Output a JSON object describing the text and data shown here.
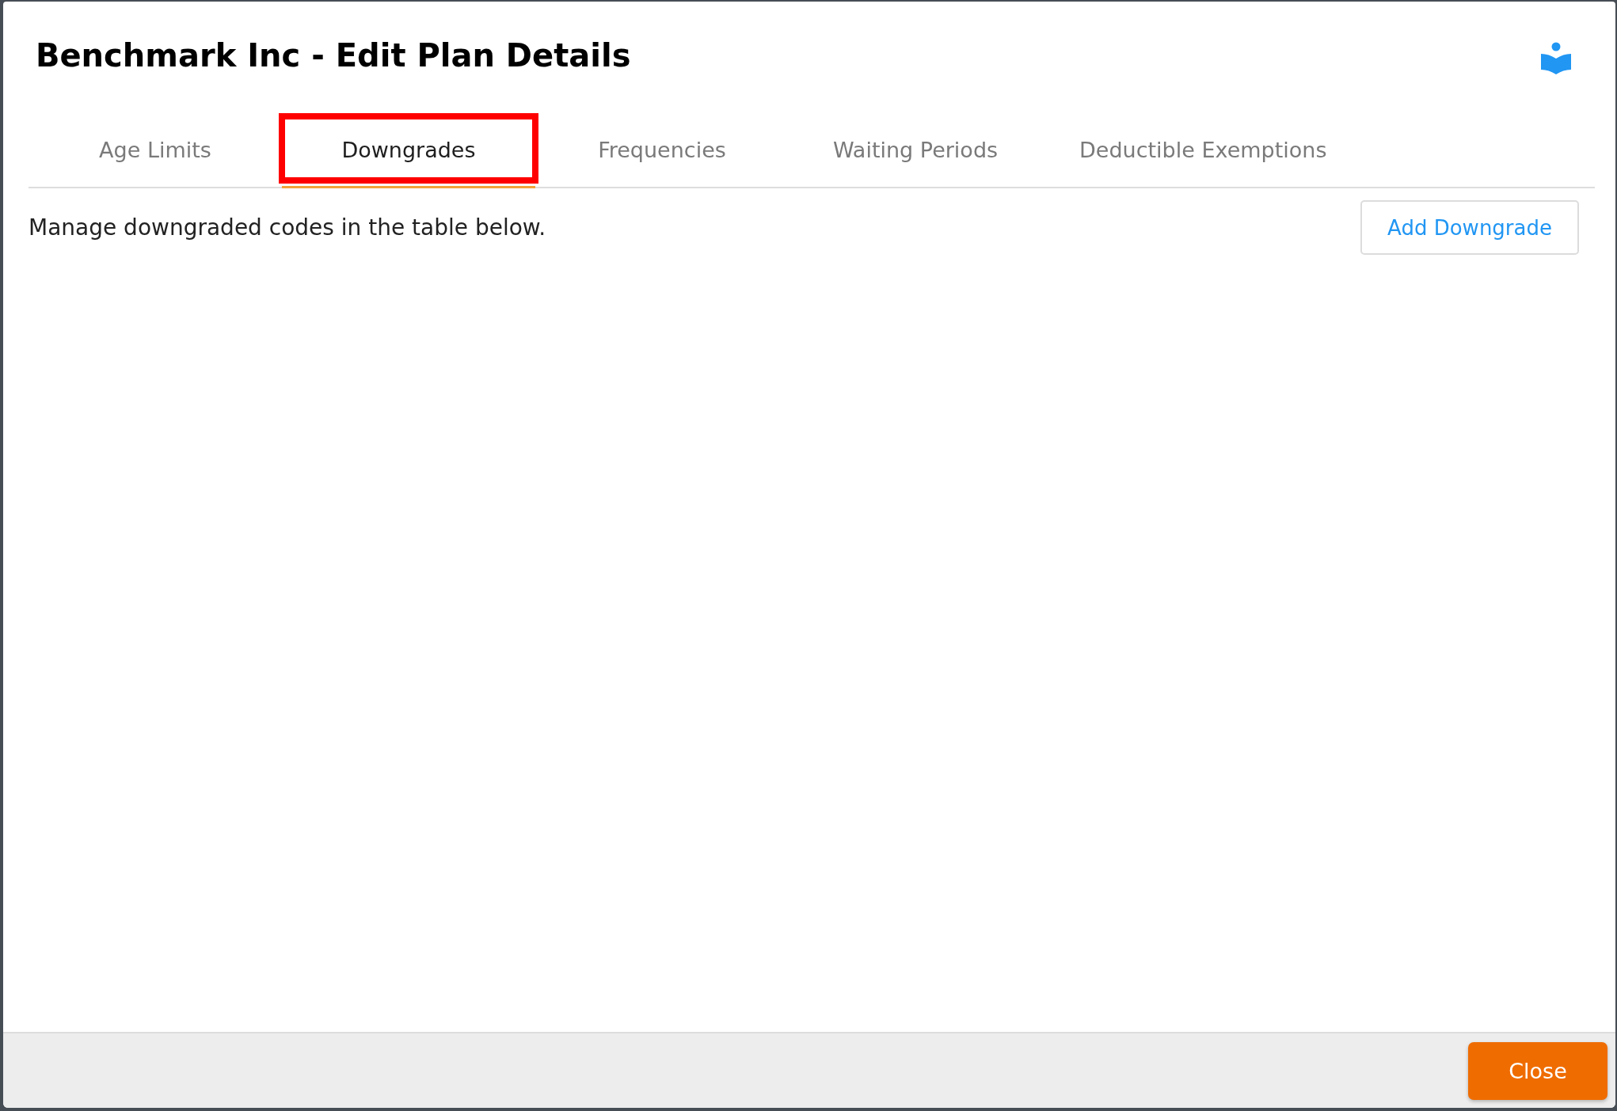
{
  "dialog": {
    "title": "Benchmark Inc - Edit Plan Details"
  },
  "tabs": [
    {
      "label": "Age Limits",
      "selected": false,
      "highlighted": false
    },
    {
      "label": "Downgrades",
      "selected": true,
      "highlighted": true
    },
    {
      "label": "Frequencies",
      "selected": false,
      "highlighted": false
    },
    {
      "label": "Waiting Periods",
      "selected": false,
      "highlighted": false
    },
    {
      "label": "Deductible Exemptions",
      "selected": false,
      "highlighted": false
    }
  ],
  "description": "Manage downgraded codes in the table below.",
  "add_button": "Add Downgrade",
  "footer_buttons": [
    "Close"
  ]
}
